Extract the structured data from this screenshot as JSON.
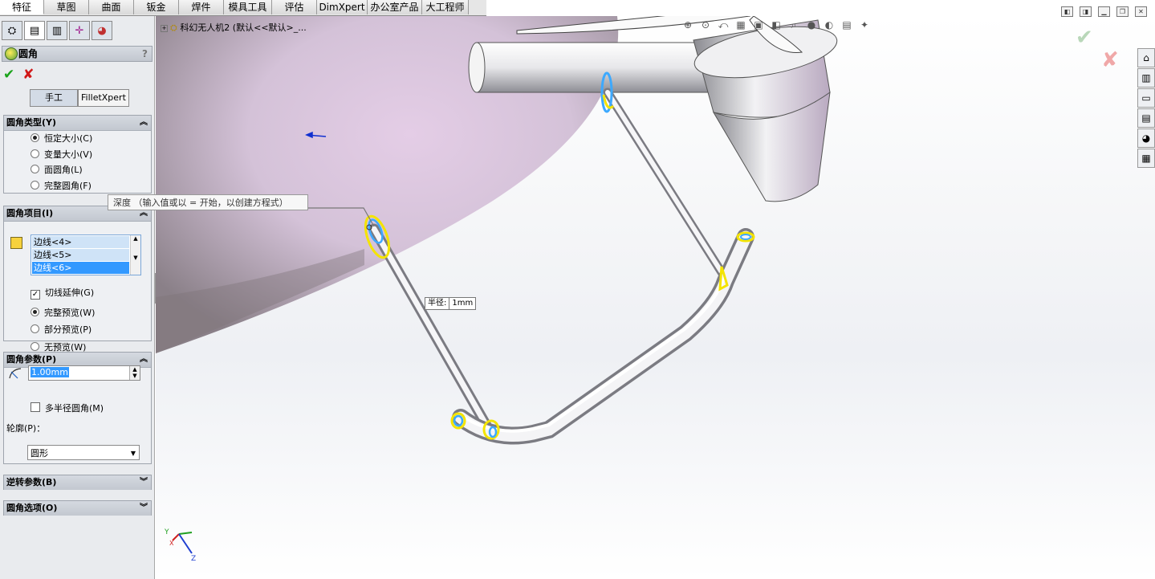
{
  "tabs": [
    {
      "label": "特征",
      "w": 55
    },
    {
      "label": "草图",
      "w": 56
    },
    {
      "label": "曲面",
      "w": 56
    },
    {
      "label": "钣金",
      "w": 56
    },
    {
      "label": "焊件",
      "w": 56
    },
    {
      "label": "模具工具",
      "w": 60
    },
    {
      "label": "评估",
      "w": 56
    },
    {
      "label": "DimXpert",
      "w": 63
    },
    {
      "label": "办公室产品",
      "w": 68
    },
    {
      "label": "大工程师",
      "w": 58
    }
  ],
  "property_manager": {
    "title": "圆角",
    "help": "?",
    "mode_manual": "手工",
    "mode_filletxpert": "FilletXpert",
    "fillet_type": {
      "header": "圆角类型(Y)",
      "options": [
        "恒定大小(C)",
        "变量大小(V)",
        "面圆角(L)",
        "完整圆角(F)"
      ],
      "selected": 0
    },
    "fillet_items": {
      "header": "圆角项目(I)",
      "edges": [
        "边线<4>",
        "边线<5>",
        "边线<6>"
      ],
      "tangent_propagation": "切线延伸(G)",
      "preview_options": [
        "完整预览(W)",
        "部分预览(P)",
        "无预览(W)"
      ],
      "preview_selected": 0
    },
    "fillet_params": {
      "header": "圆角参数(P)",
      "radius": "1.00mm",
      "multi_radius": "多半径圆角(M)",
      "profile_label": "轮廓(P)：",
      "profile_value": "圆形"
    },
    "setback": {
      "header": "逆转参数(B)"
    },
    "options": {
      "header": "圆角选项(O)"
    }
  },
  "viewport": {
    "tree_label": "科幻无人机2 (默认<<默认>_...",
    "tooltip": "深度 （输入值或以 = 开始，以创建方程式）",
    "callout_label": "半径:",
    "callout_value": "1mm",
    "triad": {
      "x": "X",
      "y": "Y",
      "z": "Z"
    }
  },
  "colors": {
    "accent": "#3399ff",
    "ok": "#1aa31a",
    "cancel": "#d01818",
    "edge_highlight": "#f4e400"
  }
}
